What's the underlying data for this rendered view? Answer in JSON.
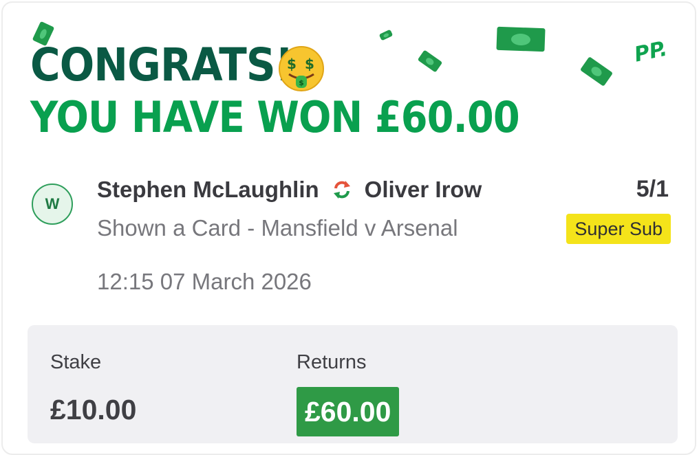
{
  "header": {
    "congrats_text": "CONGRATS!",
    "won_text": "YOU HAVE WON £60.00",
    "emoji_icon": "money-mouth-face-icon",
    "brand_mark": "PP."
  },
  "bet": {
    "status_avatar": "W",
    "player_out": "Stephen McLaughlin",
    "swap_icon": "substitution-arrows-icon",
    "player_in": "Oliver Irow",
    "odds": "5/1",
    "market": "Shown a Card - Mansfield v Arsenal",
    "badge": "Super Sub",
    "datetime": "12:15 07 March 2026"
  },
  "summary": {
    "stake_label": "Stake",
    "stake_value": "£10.00",
    "returns_label": "Returns",
    "returns_value": "£60.00"
  },
  "colors": {
    "congrats": "#0a5944",
    "won": "#09a04f",
    "badge": "#f4e31a",
    "returns_bg": "#2f9a46",
    "bill": "#1f9a4b"
  }
}
